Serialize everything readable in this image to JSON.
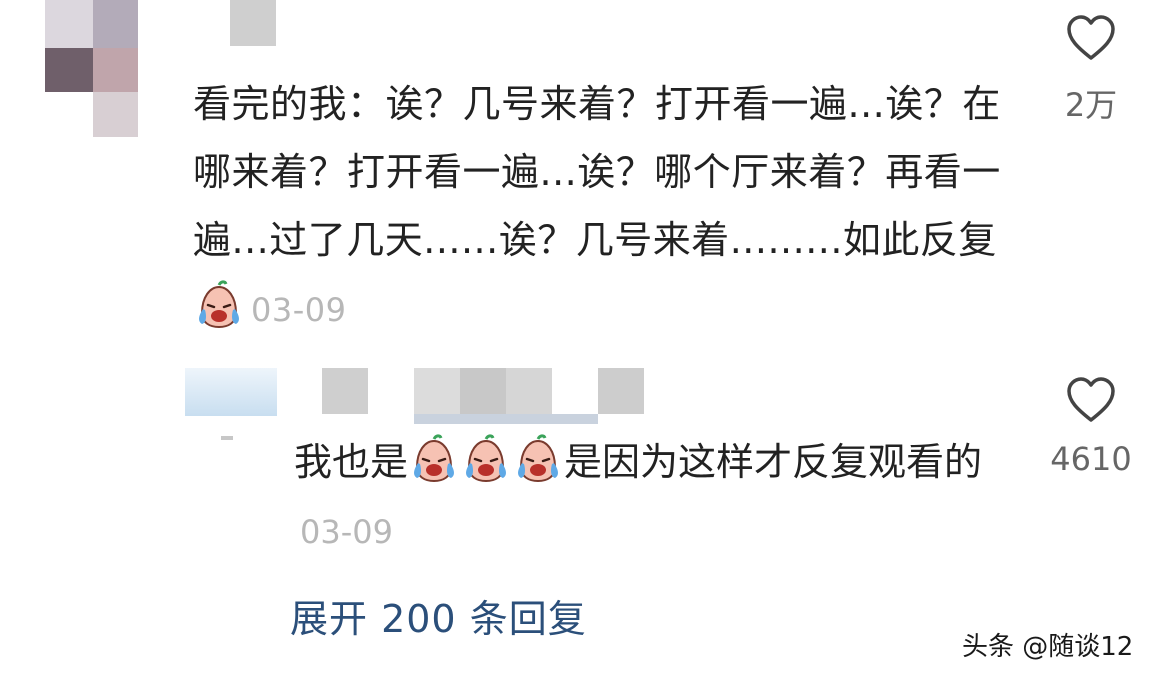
{
  "comment": {
    "text_part1": "看完的我：诶？几号来着？打开看一遍...诶？在哪来着？打开看一遍...诶？哪个厅来着？再看一遍...过了几天......诶？几号来着.........如此反复",
    "date": "03-09",
    "likes": "2万",
    "emoji": "crying-face-emoji"
  },
  "reply": {
    "text_before_emoji": "我也是",
    "text_after_emoji": "是因为这样才反复观看的",
    "date": "03-09",
    "likes": "4610",
    "emoji": "crying-face-emoji"
  },
  "expand_replies": "展开 200 条回复",
  "watermark": "头条 @随谈12",
  "colors": {
    "link": "#2b4f7a",
    "date": "#b7b7b7",
    "text": "#222222"
  }
}
